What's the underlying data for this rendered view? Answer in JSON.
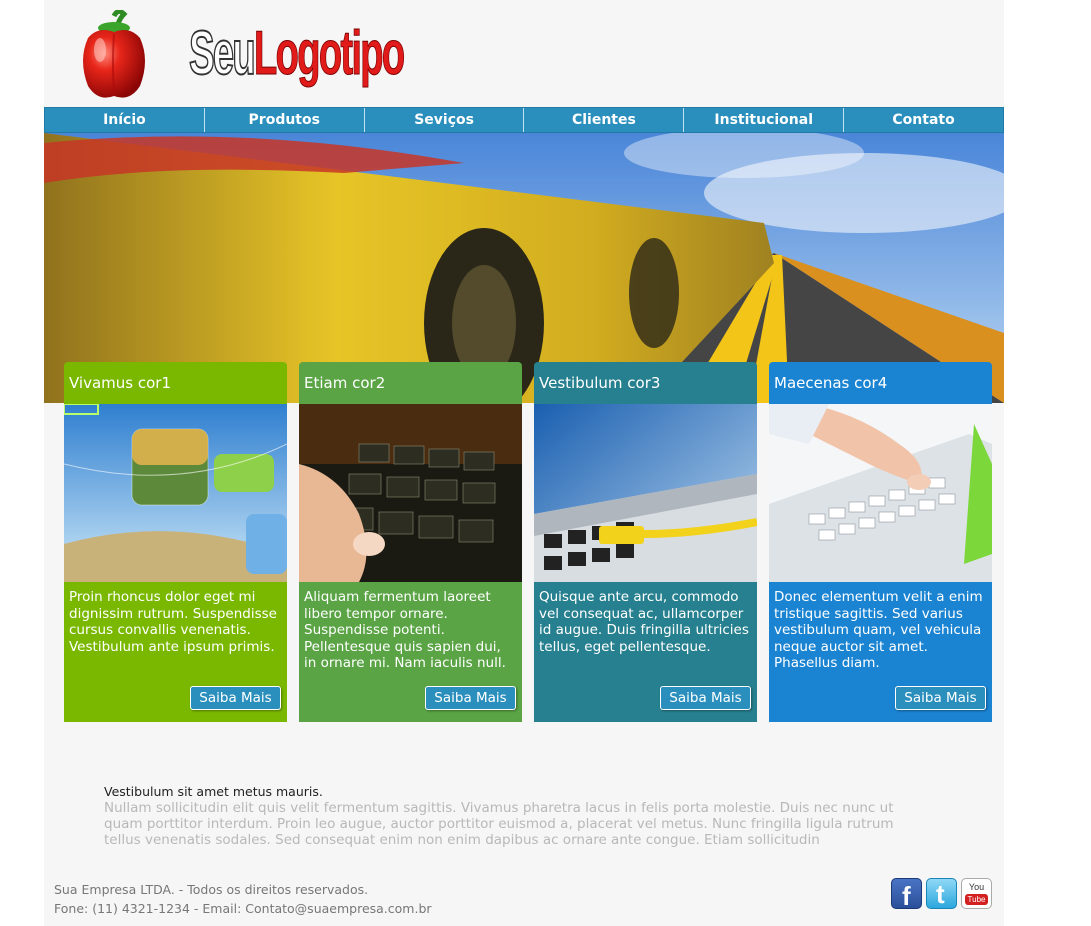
{
  "logo": {
    "part1": "Seu",
    "part2": "Logotipo"
  },
  "nav": {
    "items": [
      {
        "label": "Início"
      },
      {
        "label": "Produtos"
      },
      {
        "label": "Seviços"
      },
      {
        "label": "Clientes"
      },
      {
        "label": "Institucional"
      },
      {
        "label": "Contato"
      }
    ]
  },
  "cards": [
    {
      "title": "Vivamus cor1",
      "text": "Proin rhoncus dolor eget mi dignissim rutrum. Suspendisse cursus convallis venenatis. Vestibulum ante ipsum primis.",
      "button": "Saiba Mais",
      "color": "#7ab800"
    },
    {
      "title": "Etiam cor2",
      "text": "Aliquam fermentum laoreet libero tempor ornare. Suspendisse potenti. Pellentesque quis sapien dui, in ornare mi. Nam iaculis null.",
      "button": "Saiba Mais",
      "color": "#5aa445"
    },
    {
      "title": "Vestibulum cor3",
      "text": "Quisque ante arcu, commodo vel consequat ac, ullamcorper id augue. Duis fringilla ultricies tellus, eget pellentesque.",
      "button": "Saiba Mais",
      "color": "#27808f"
    },
    {
      "title": "Maecenas cor4",
      "text": "Donec elementum velit a enim tristique sagittis. Sed varius vestibulum quam, vel vehicula neque auctor sit amet. Phasellus diam.",
      "button": "Saiba Mais",
      "color": "#1b84d2"
    }
  ],
  "article": {
    "title": "Vestibulum sit amet metus mauris.",
    "body": "Nullam sollicitudin elit quis velit fermentum sagittis. Vivamus pharetra lacus in felis porta molestie. Duis nec nunc ut quam porttitor interdum. Proin leo augue, auctor porttitor euismod a, placerat vel metus. Nunc fringilla ligula rutrum tellus venenatis sodales. Sed consequat enim non enim dapibus ac ornare ante congue. Etiam sollicitudin"
  },
  "footer": {
    "line1": "Sua Empresa LTDA. - Todos os direitos reservados.",
    "line2": "Fone: (11) 4321-1234 - Email: Contato@suaempresa.com.br"
  },
  "social": [
    {
      "icon": "facebook-icon",
      "glyph": "f"
    },
    {
      "icon": "twitter-icon",
      "glyph": "t"
    },
    {
      "icon": "youtube-icon",
      "label_top": "You",
      "label_bottom": "Tube"
    }
  ],
  "colors": {
    "nav": "#2a8fbd",
    "page_bg": "#f6f6f6",
    "logo_red": "#e11a1a"
  }
}
